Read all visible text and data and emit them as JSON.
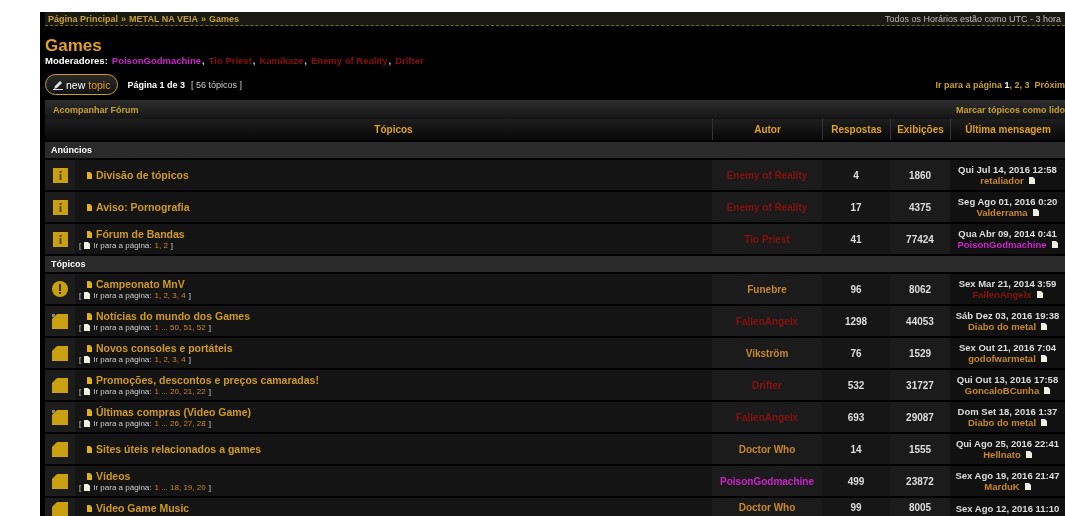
{
  "breadcrumb": {
    "links": [
      "Página Principal",
      "METAL NA VEIA",
      "Games"
    ],
    "separator": "»",
    "timezone": "Todos os Horários estão como UTC - 3 hora"
  },
  "forum": {
    "title": "Games",
    "moderators_label": "Moderadores:",
    "moderators": [
      {
        "name": "PoisonGodmachine",
        "color": "#cc22cc",
        "sep": ","
      },
      {
        "name": "Tio Priest",
        "color": "#8a1010",
        "sep": ","
      },
      {
        "name": "Kamikaze",
        "color": "#8a1010",
        "sep": ","
      },
      {
        "name": "Enemy of Reality",
        "color": "#8a1010",
        "sep": ","
      },
      {
        "name": "Drifter",
        "color": "#8a1010"
      }
    ]
  },
  "toolbar": {
    "new_topic": {
      "main": "new",
      "accent": "topic"
    },
    "page_info": "Página 1 de 3",
    "topic_count": "[ 56 tópicos ]",
    "jump": "Ir para a página **1**, 2, 3  Próxim"
  },
  "bar": {
    "watch": "Acompanhar Fórum",
    "mark_read": "Marcar tópicos como lido"
  },
  "columns": [
    "Tópicos",
    "Autor",
    "Respostas",
    "Exibições",
    "Última mensagem"
  ],
  "sections": [
    {
      "label": "Anúncios",
      "rows": [
        {
          "kind": "announcement",
          "title": "Divisão de tópicos",
          "author": {
            "name": "Enemy of Reality",
            "color": "#8a1010"
          },
          "replies": "4",
          "views": "1860",
          "last": {
            "date": "Qui Jul 14, 2016 12:58",
            "user": {
              "name": "retaliador",
              "color": "#c8872a"
            }
          }
        },
        {
          "kind": "announcement",
          "title": "Aviso: Pornografia",
          "author": {
            "name": "Enemy of Reality",
            "color": "#8a1010"
          },
          "replies": "17",
          "views": "4375",
          "last": {
            "date": "Seg Ago 01, 2016 0:20",
            "user": {
              "name": "Valderrama",
              "color": "#c8872a"
            }
          }
        },
        {
          "kind": "announcement",
          "title": "Fórum de Bandas",
          "pagination": {
            "open": "[",
            "label": "Ir para a página:",
            "pages": "1, 2",
            "close": "]"
          },
          "author": {
            "name": "Tio Priest",
            "color": "#8a1010"
          },
          "replies": "41",
          "views": "77424",
          "last": {
            "date": "Qua Abr 09, 2014 0:41",
            "user": {
              "name": "PoisonGodmachine",
              "color": "#cc22cc"
            }
          }
        }
      ]
    },
    {
      "label": "Tópicos",
      "rows": [
        {
          "kind": "sticky",
          "title": "Campeonato MnV",
          "pagination": {
            "open": "[",
            "label": "Ir para a página:",
            "pages": "1, 2, 3, 4",
            "close": "]"
          },
          "author": {
            "name": "Funebre",
            "color": "#c8872a"
          },
          "replies": "96",
          "views": "8062",
          "last": {
            "date": "Sex Mar 21, 2014 3:59",
            "user": {
              "name": "FallenAngelx",
              "color": "#8a1010"
            }
          }
        },
        {
          "kind": "topic_unread",
          "title": "Notícias do mundo dos Games",
          "pagination": {
            "open": "[",
            "label": "Ir para a página:",
            "pages": "1 ... 50, 51, 52",
            "close": "]"
          },
          "author": {
            "name": "FallenAngelx",
            "color": "#8a1010"
          },
          "replies": "1298",
          "views": "44053",
          "last": {
            "date": "Sáb Dez 03, 2016 19:38",
            "user": {
              "name": "Diabo do metal",
              "color": "#c8872a"
            }
          }
        },
        {
          "kind": "topic",
          "title": "Novos consoles e portáteis",
          "pagination": {
            "open": "[",
            "label": "Ir para a página:",
            "pages": "1, 2, 3, 4",
            "close": "]"
          },
          "author": {
            "name": "Vikström",
            "color": "#c8872a"
          },
          "replies": "76",
          "views": "1529",
          "last": {
            "date": "Sex Out 21, 2016 7:04",
            "user": {
              "name": "godofwarmetal",
              "color": "#c8872a"
            }
          }
        },
        {
          "kind": "topic",
          "title": "Promoções, descontos e preços camaradas!",
          "pagination": {
            "open": "[",
            "label": "Ir para a página:",
            "pages": "1 ... 20, 21, 22",
            "close": "]"
          },
          "author": {
            "name": "Drifter",
            "color": "#8a1010"
          },
          "replies": "532",
          "views": "31727",
          "last": {
            "date": "Qui Out 13, 2016 17:58",
            "user": {
              "name": "GoncaloBCunha",
              "color": "#c8872a"
            }
          }
        },
        {
          "kind": "topic_unread",
          "title": "Últimas compras (Video Game)",
          "pagination": {
            "open": "[",
            "label": "Ir para a página:",
            "pages": "1 ... 26, 27, 28",
            "close": "]"
          },
          "author": {
            "name": "FallenAngelx",
            "color": "#8a1010"
          },
          "replies": "693",
          "views": "29087",
          "last": {
            "date": "Dom Set 18, 2016 1:37",
            "user": {
              "name": "Diabo do metal",
              "color": "#c8872a"
            }
          }
        },
        {
          "kind": "topic",
          "title": "Sites úteis relacionados a games",
          "author": {
            "name": "Doctor Who",
            "color": "#c8872a"
          },
          "replies": "14",
          "views": "1555",
          "last": {
            "date": "Qui Ago 25, 2016 22:41",
            "user": {
              "name": "Hellnato",
              "color": "#c8872a"
            }
          }
        },
        {
          "kind": "topic",
          "title": "Vídeos",
          "pagination": {
            "open": "[",
            "label": "Ir para a página:",
            "pages": "1 ... 18, 19, 20",
            "close": "]"
          },
          "author": {
            "name": "PoisonGodmachine",
            "color": "#cc22cc"
          },
          "replies": "499",
          "views": "23872",
          "last": {
            "date": "Sex Ago 19, 2016 21:47",
            "user": {
              "name": "MarduK",
              "color": "#c8872a"
            }
          }
        },
        {
          "kind": "topic",
          "title": "Video Game Music",
          "author": {
            "name": "Doctor Who",
            "color": "#c8872a"
          },
          "replies": "99",
          "views": "8005",
          "last": {
            "date": "Sex Ago 12, 2016 11:10"
          }
        }
      ]
    }
  ]
}
